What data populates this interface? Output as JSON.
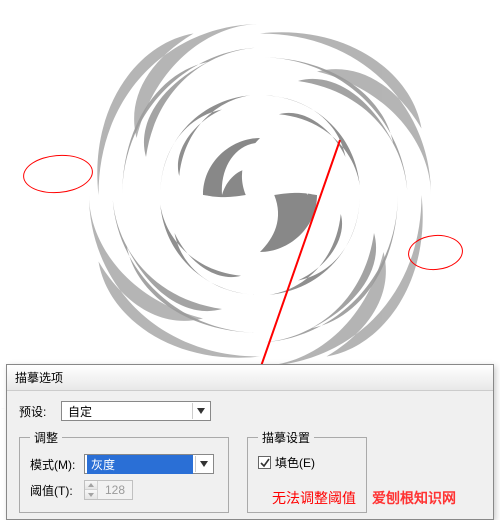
{
  "dialog": {
    "title": "描摹选项",
    "preset_label": "预设:",
    "preset_value": "自定",
    "adjust_legend": "调整",
    "mode_label": "模式(M):",
    "mode_value": "灰度",
    "threshold_label": "阈值(T):",
    "threshold_value": "128",
    "trace_legend": "描摹设置",
    "fill_label": "填色(E)"
  },
  "annotations": {
    "cannot_adjust": "无法调整阈值",
    "watermark": "爱刨根知识网"
  }
}
